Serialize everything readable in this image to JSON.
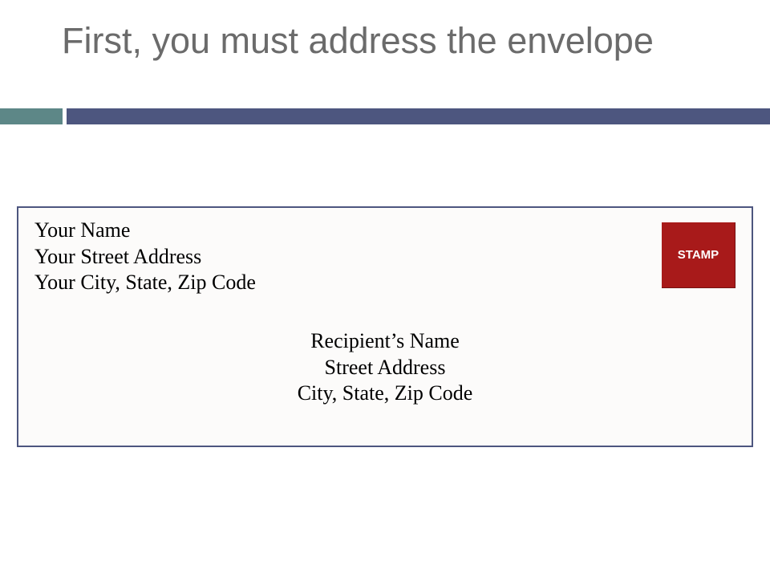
{
  "title": "First, you must address the envelope",
  "envelope": {
    "return_address": {
      "name": "Your Name",
      "street": "Your Street Address",
      "city_state_zip": "Your City, State, Zip Code"
    },
    "recipient_address": {
      "name": "Recipient’s Name",
      "street": "Street Address",
      "city_state_zip": "City, State, Zip Code"
    },
    "stamp_label": "STAMP"
  }
}
